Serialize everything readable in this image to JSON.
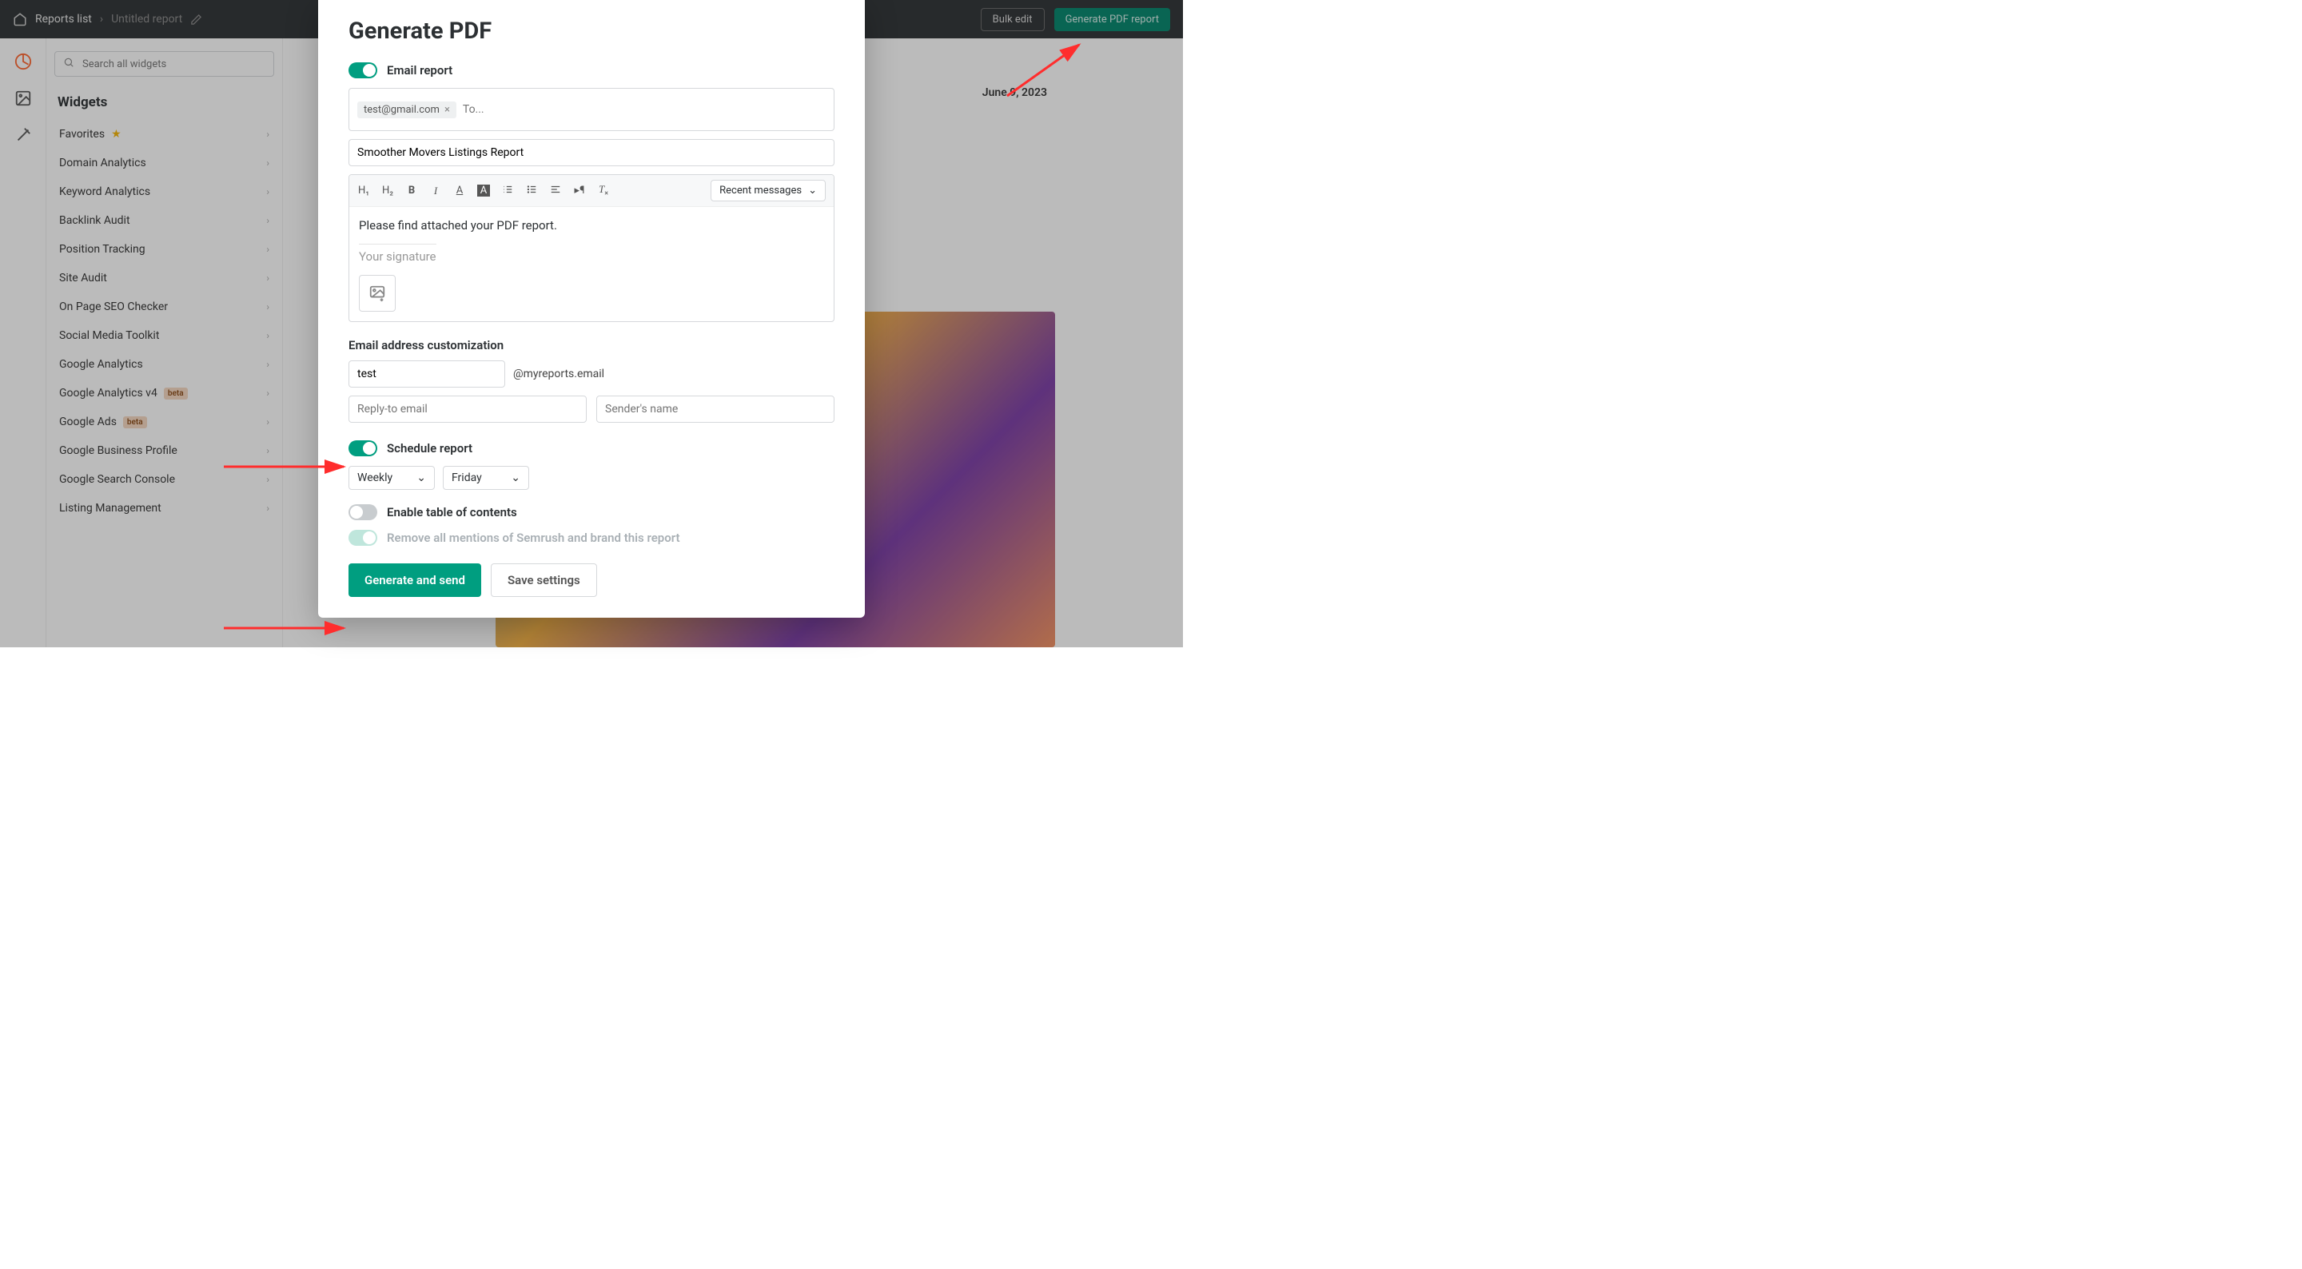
{
  "topbar": {
    "crumb_root": "Reports list",
    "crumb_current": "Untitled report",
    "bulk_edit": "Bulk edit",
    "generate": "Generate PDF report"
  },
  "sidebar": {
    "search_placeholder": "Search all widgets",
    "header": "Widgets",
    "items": [
      {
        "label": "Favorites",
        "fav": true
      },
      {
        "label": "Domain Analytics"
      },
      {
        "label": "Keyword Analytics"
      },
      {
        "label": "Backlink Audit"
      },
      {
        "label": "Position Tracking"
      },
      {
        "label": "Site Audit"
      },
      {
        "label": "On Page SEO Checker"
      },
      {
        "label": "Social Media Toolkit"
      },
      {
        "label": "Google Analytics"
      },
      {
        "label": "Google Analytics v4",
        "beta": true
      },
      {
        "label": "Google Ads",
        "beta": true
      },
      {
        "label": "Google Business Profile"
      },
      {
        "label": "Google Search Console"
      },
      {
        "label": "Listing Management"
      }
    ],
    "beta_text": "beta"
  },
  "canvas": {
    "date": "June 9, 2023"
  },
  "modal": {
    "title": "Generate PDF",
    "email_report_label": "Email report",
    "to_placeholder": "To...",
    "chip_email": "test@gmail.com",
    "subject_value": "Smoother Movers Listings Report",
    "recent_messages": "Recent messages",
    "body_text": "Please find attached your PDF report.",
    "signature_placeholder": "Your signature",
    "email_custom_header": "Email address customization",
    "email_prefix_value": "test",
    "email_suffix": "@myreports.email",
    "reply_to_placeholder": "Reply-to email",
    "sender_name_placeholder": "Sender's name",
    "schedule_label": "Schedule report",
    "schedule_freq": "Weekly",
    "schedule_day": "Friday",
    "toc_label": "Enable table of contents",
    "brand_label": "Remove all mentions of Semrush and brand this report",
    "generate_btn": "Generate and send",
    "save_btn": "Save settings"
  }
}
